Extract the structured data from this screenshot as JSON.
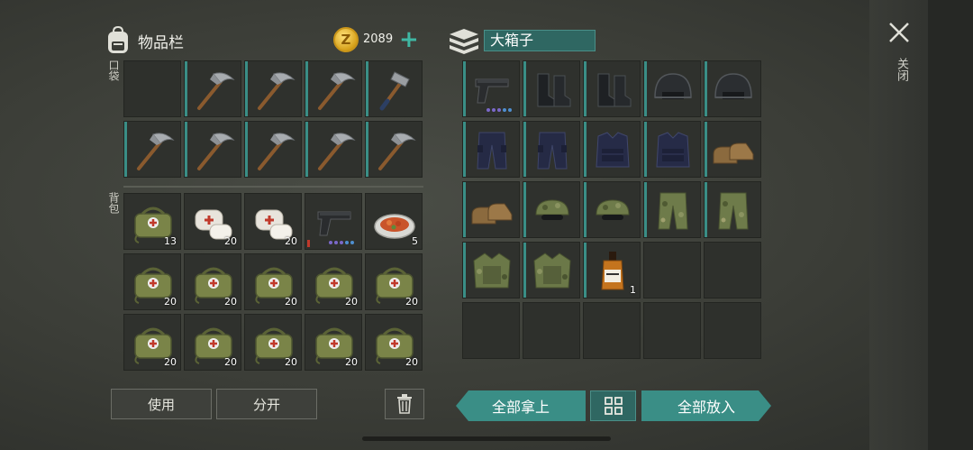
{
  "inventory": {
    "title": "物品栏",
    "currency_amount": "2089",
    "add_currency_symbol": "+",
    "pocket_label": "口袋",
    "backpack_label": "背包",
    "pocket_items": [
      {
        "icon": "empty-slot",
        "qty": ""
      },
      {
        "icon": "pickaxe-icon",
        "qty": ""
      },
      {
        "icon": "pickaxe-icon",
        "qty": ""
      },
      {
        "icon": "pickaxe-icon",
        "qty": ""
      },
      {
        "icon": "hammer-icon",
        "qty": ""
      },
      {
        "icon": "pickaxe-icon",
        "qty": ""
      },
      {
        "icon": "pickaxe-icon",
        "qty": ""
      },
      {
        "icon": "pickaxe-icon",
        "qty": ""
      },
      {
        "icon": "pickaxe-icon",
        "qty": ""
      },
      {
        "icon": "pickaxe-icon",
        "qty": ""
      }
    ],
    "backpack_items": [
      {
        "icon": "medkit-icon",
        "qty": "13"
      },
      {
        "icon": "bandage-icon",
        "qty": "20"
      },
      {
        "icon": "bandage-icon",
        "qty": "20"
      },
      {
        "icon": "pistol-icon",
        "qty": ""
      },
      {
        "icon": "food-plate-icon",
        "qty": "5"
      },
      {
        "icon": "medkit-icon",
        "qty": "20"
      },
      {
        "icon": "medkit-icon",
        "qty": "20"
      },
      {
        "icon": "medkit-icon",
        "qty": "20"
      },
      {
        "icon": "medkit-icon",
        "qty": "20"
      },
      {
        "icon": "medkit-icon",
        "qty": "20"
      },
      {
        "icon": "medkit-icon",
        "qty": "20"
      },
      {
        "icon": "medkit-icon",
        "qty": "20"
      },
      {
        "icon": "medkit-icon",
        "qty": "20"
      },
      {
        "icon": "medkit-icon",
        "qty": "20"
      },
      {
        "icon": "medkit-icon",
        "qty": "20"
      }
    ],
    "use_button": "使用",
    "split_button": "分开"
  },
  "container": {
    "name": "大箱子",
    "items": [
      {
        "icon": "pistol-icon",
        "qty": ""
      },
      {
        "icon": "boots-icon",
        "qty": ""
      },
      {
        "icon": "boots-icon",
        "qty": ""
      },
      {
        "icon": "helmet-icon",
        "qty": ""
      },
      {
        "icon": "helmet-icon",
        "qty": ""
      },
      {
        "icon": "pants-dark-icon",
        "qty": ""
      },
      {
        "icon": "pants-dark-icon",
        "qty": ""
      },
      {
        "icon": "vest-dark-icon",
        "qty": ""
      },
      {
        "icon": "vest-dark-icon",
        "qty": ""
      },
      {
        "icon": "shoes-brown-icon",
        "qty": ""
      },
      {
        "icon": "shoes-brown-icon",
        "qty": ""
      },
      {
        "icon": "cap-camo-icon",
        "qty": ""
      },
      {
        "icon": "cap-camo-icon",
        "qty": ""
      },
      {
        "icon": "pants-camo-icon",
        "qty": ""
      },
      {
        "icon": "pants-camo-icon",
        "qty": ""
      },
      {
        "icon": "jacket-camo-icon",
        "qty": ""
      },
      {
        "icon": "jacket-camo-icon",
        "qty": ""
      },
      {
        "icon": "whiskey-bottle-icon",
        "qty": "1"
      }
    ],
    "take_all_button": "全部拿上",
    "put_all_button": "全部放入"
  },
  "close_label": "关闭",
  "colors": {
    "accent_teal": "#3a8e86",
    "coin_gold": "#d7a21b",
    "ammo_dot_purple": "#7b68c9",
    "ammo_dot_blue": "#4f8fd0"
  }
}
